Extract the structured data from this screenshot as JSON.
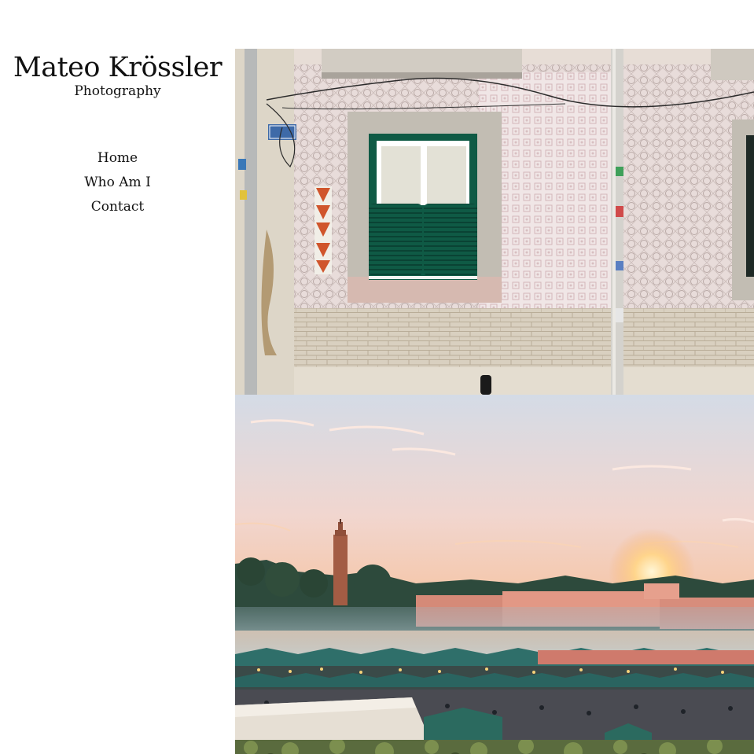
{
  "site": {
    "title": "Mateo Krössler",
    "subtitle": "Photography"
  },
  "nav": {
    "items": [
      {
        "label": "Home"
      },
      {
        "label": "Who Am I"
      },
      {
        "label": "Contact"
      }
    ]
  },
  "gallery": {
    "photos": [
      {
        "subject": "tiled-building-facade-with-green-shutters",
        "sign_text": "Avenida da Liberdade"
      },
      {
        "subject": "market-square-at-sunset-with-minaret"
      },
      {
        "subject": "foliage-partial"
      }
    ]
  },
  "colors": {
    "background": "#ffffff",
    "text": "#111111",
    "shutter_green": "#0f5a45",
    "tile_orange": "#d0552c",
    "sunset_orange": "#f6b074",
    "market_teal": "#2f6f6a"
  }
}
